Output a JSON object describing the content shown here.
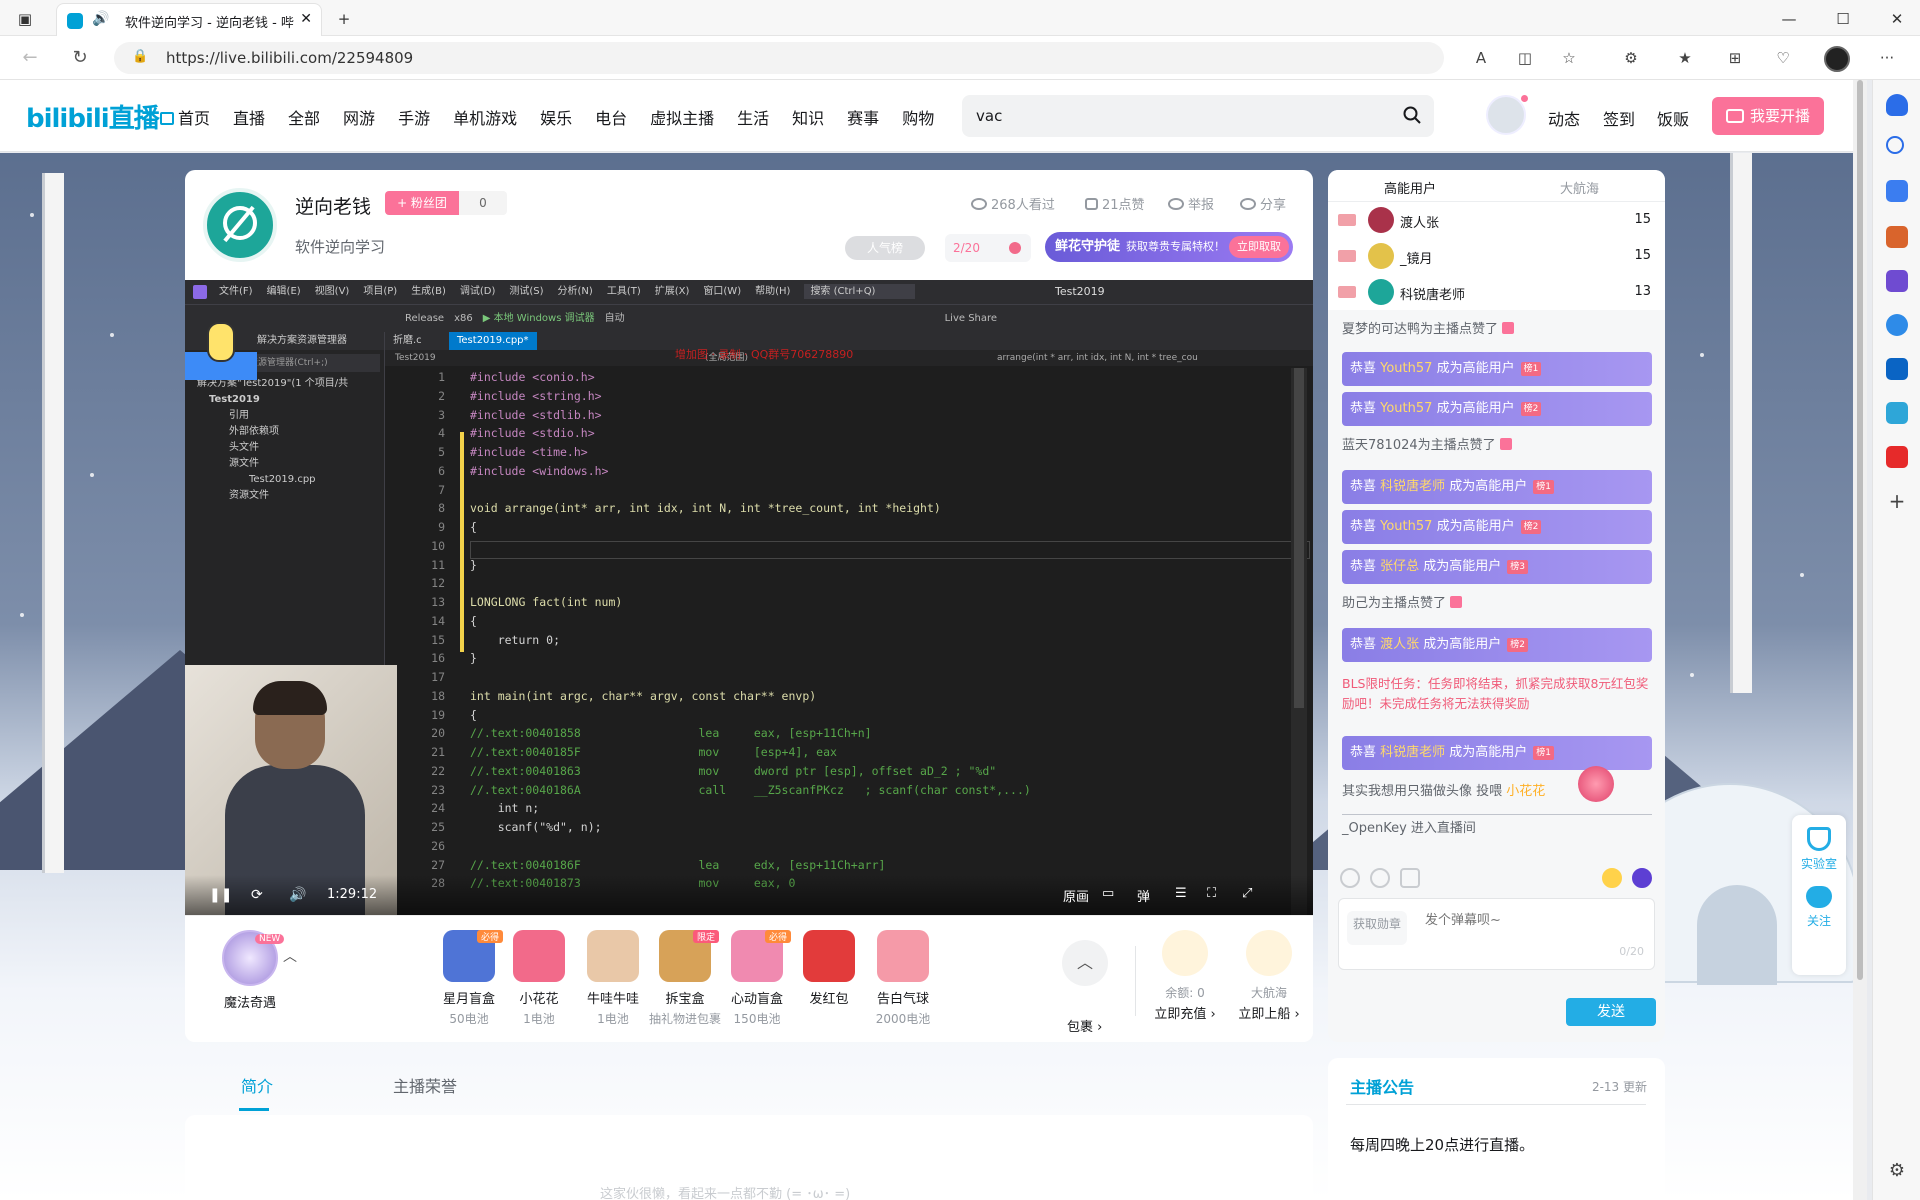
{
  "browser": {
    "tab_title": "软件逆向学习 - 逆向老钱 - 哔",
    "url": "https://live.bilibili.com/22594809",
    "new_tab": "+",
    "minimize": "—",
    "maximize": "☐",
    "close": "✕",
    "more": "···"
  },
  "header": {
    "logo": "bilibili直播",
    "nav": [
      "首页",
      "直播",
      "全部",
      "网游",
      "手游",
      "单机游戏",
      "娱乐",
      "电台",
      "虚拟主播",
      "生活",
      "知识",
      "赛事",
      "购物"
    ],
    "search_value": "vac",
    "links": [
      "动态",
      "签到",
      "饭贩"
    ],
    "go_live": "我要开播"
  },
  "room": {
    "streamer": "逆向老钱",
    "fan_button": "+ 粉丝团",
    "fan_count": "0",
    "area": "软件逆向学习",
    "viewers": "268人看过",
    "likes": "21点赞",
    "report": "举报",
    "share": "分享",
    "popularity": "人气榜",
    "rank": "2/20",
    "guard_title": "鲜花守护徒",
    "guard_text": "获取尊贵专属特权！",
    "guard_get": "立即取取"
  },
  "vs": {
    "menu": [
      "文件(F)",
      "编辑(E)",
      "视图(V)",
      "项目(P)",
      "生成(B)",
      "调试(D)",
      "测试(S)",
      "分析(N)",
      "工具(T)",
      "扩展(X)",
      "窗口(W)",
      "帮助(H)",
      "搜索 (Ctrl+Q)"
    ],
    "project": "Test2019",
    "toolbar": [
      "Release",
      "x86",
      "▶ 本地 Windows 调试器",
      "自动",
      "Live Share"
    ],
    "solution_header": "解决方案资源管理器",
    "solution_search": "搜索解决方案资源管理器(Ctrl+;)",
    "tree": [
      "解决方案\"Test2019\"(1 个项目/共",
      "Test2019",
      "引用",
      "外部依赖项",
      "头文件",
      "源文件",
      "Test2019.cpp",
      "资源文件"
    ],
    "tabs": [
      "折磨.c",
      "Test2019.cpp*"
    ],
    "nav_left": "Test2019",
    "nav_mid": "(全局范围)",
    "nav_right": "arrange(int * arr, int idx, int N, int * tree_cou",
    "watermark": "增加图 · 录制 · QQ群号706278890",
    "code": [
      [
        "1",
        "#include <conio.h>"
      ],
      [
        "2",
        "#include <string.h>"
      ],
      [
        "3",
        "#include <stdlib.h>"
      ],
      [
        "4",
        "#include <stdio.h>"
      ],
      [
        "5",
        "#include <time.h>"
      ],
      [
        "6",
        "#include <windows.h>"
      ],
      [
        "7",
        ""
      ],
      [
        "8",
        "void arrange(int* arr, int idx, int N, int *tree_count, int *height)"
      ],
      [
        "9",
        "{"
      ],
      [
        "10",
        ""
      ],
      [
        "11",
        "}"
      ],
      [
        "12",
        ""
      ],
      [
        "13",
        "LONGLONG fact(int num)"
      ],
      [
        "14",
        "{"
      ],
      [
        "15",
        "    return 0;"
      ],
      [
        "16",
        "}"
      ],
      [
        "17",
        ""
      ],
      [
        "18",
        "int main(int argc, char** argv, const char** envp)"
      ],
      [
        "19",
        "{"
      ],
      [
        "20",
        "//.text:00401858                 lea     eax, [esp+11Ch+n]"
      ],
      [
        "21",
        "//.text:0040185F                 mov     [esp+4], eax"
      ],
      [
        "22",
        "//.text:00401863                 mov     dword ptr [esp], offset aD_2 ; \"%d\""
      ],
      [
        "23",
        "//.text:0040186A                 call    __Z5scanfPKcz   ; scanf(char const*,...)"
      ],
      [
        "24",
        "    int n;"
      ],
      [
        "25",
        "    scanf(\"%d\", n);"
      ],
      [
        "26",
        ""
      ],
      [
        "27",
        "//.text:0040186F                 lea     edx, [esp+11Ch+arr]"
      ],
      [
        "28",
        "//.text:00401873                 mov     eax, 0"
      ]
    ]
  },
  "player": {
    "time": "1:29:12",
    "quality": "原画",
    "danmaku": "弹"
  },
  "gifts": {
    "magic": "魔法奇遇",
    "magic_new": "NEW",
    "items": [
      {
        "name": "星月盲盒",
        "price": "50电池",
        "tag": "必得",
        "color": "#4f74d6"
      },
      {
        "name": "小花花",
        "price": "1电池",
        "tag": "",
        "color": "#f26a8a"
      },
      {
        "name": "牛哇牛哇",
        "price": "1电池",
        "tag": "",
        "color": "#e9c8a8"
      },
      {
        "name": "拆宝盒",
        "price": "抽礼物进包裹",
        "tag": "限定",
        "color": "#d7a258"
      },
      {
        "name": "心动盲盒",
        "price": "150电池",
        "tag": "必得",
        "color": "#f08ab0"
      },
      {
        "name": "发红包",
        "price": "",
        "tag": "",
        "color": "#e23b3b"
      },
      {
        "name": "告白气球",
        "price": "2000电池",
        "tag": "",
        "color": "#f59aa8"
      }
    ],
    "package": "包裹 ›",
    "balance": "余额: 0",
    "recharge": "立即充值 ›",
    "voyage_label": "大航海",
    "voyage_action": "立即上船 ›"
  },
  "tabs": {
    "intro": "简介",
    "honor": "主播荣誉",
    "empty": "这家伙很懒，看起来一点都不勤 (= ･ω･ =)"
  },
  "side": {
    "tab_high": "高能用户",
    "tab_voyage": "大航海",
    "rank": [
      {
        "name": "渡人张",
        "score": "15"
      },
      {
        "name": "_镜月",
        "score": "15"
      },
      {
        "name": "科锐唐老师",
        "score": "13"
      }
    ],
    "messages": [
      {
        "type": "like",
        "text": "夏梦的可达鸭为主播点赞了"
      },
      {
        "type": "congrats",
        "pre": "恭喜 ",
        "name": "Youth57",
        "post": " 成为高能用户",
        "lv": "榜1"
      },
      {
        "type": "congrats",
        "pre": "恭喜 ",
        "name": "Youth57",
        "post": " 成为高能用户",
        "lv": "榜2"
      },
      {
        "type": "like",
        "text": "蓝天781024为主播点赞了"
      },
      {
        "type": "congrats",
        "pre": "恭喜 ",
        "name": "科锐唐老师",
        "post": " 成为高能用户",
        "lv": "榜1"
      },
      {
        "type": "congrats",
        "pre": "恭喜 ",
        "name": "Youth57",
        "post": " 成为高能用户",
        "lv": "榜2"
      },
      {
        "type": "congrats",
        "pre": "恭喜 ",
        "name": "张仔总",
        "post": " 成为高能用户",
        "lv": "榜3"
      },
      {
        "type": "like",
        "text": "助己为主播点赞了"
      },
      {
        "type": "congrats",
        "pre": "恭喜 ",
        "name": "渡人张",
        "post": " 成为高能用户",
        "lv": "榜2"
      },
      {
        "type": "bls",
        "text": "BLS限时任务：任务即将结束，抓紧完成获取8元红包奖励吧！未完成任务将无法获得奖励"
      },
      {
        "type": "congrats",
        "pre": "恭喜 ",
        "name": "科锐唐老师",
        "post": " 成为高能用户",
        "lv": "榜1"
      },
      {
        "type": "gift",
        "text": "其实我想用只猫做头像 投喂 ",
        "gift": "小花花"
      },
      {
        "type": "enter",
        "text": "_OpenKey 进入直播间"
      }
    ],
    "medal": "获取勋章",
    "input_placeholder": "发个弹幕呗~",
    "count": "0/20",
    "send": "发送"
  },
  "notice": {
    "title": "主播公告",
    "date": "2-13 更新",
    "content": "每周四晚上20点进行直播。"
  },
  "floating": {
    "lab": "实验室",
    "follow": "关注"
  }
}
